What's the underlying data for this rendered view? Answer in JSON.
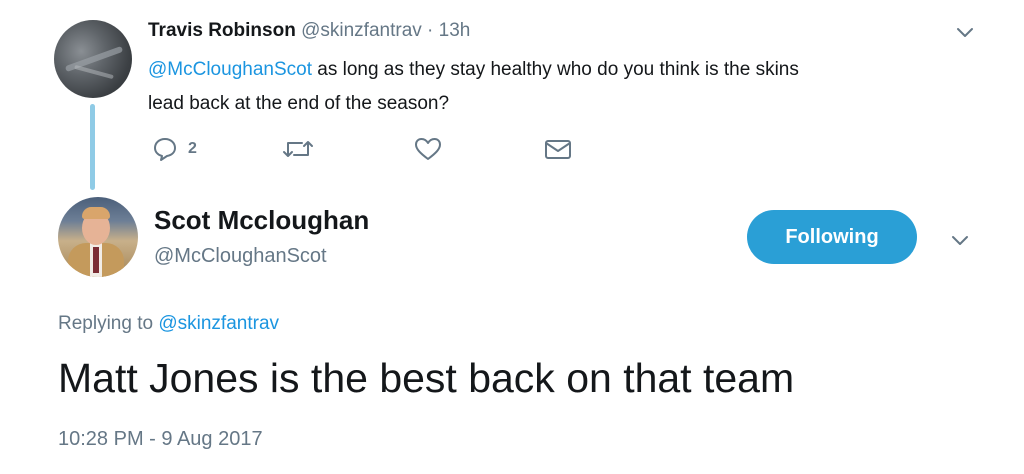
{
  "parent_tweet": {
    "author_name": "Travis Robinson",
    "author_handle": "@skinzfantrav",
    "separator": "·",
    "time": "13h",
    "mention": "@McCloughanScot",
    "text_line1": " as long as they stay healthy who do you think is the skins",
    "text_line2": "lead back at the end of the season?",
    "reply_count": "2",
    "icons": [
      "reply-icon",
      "retweet-icon",
      "like-icon",
      "message-icon",
      "chevron-down-icon"
    ]
  },
  "main_tweet": {
    "author_name": "Scot Mccloughan",
    "author_handle": "@McCloughanScot",
    "follow_label": "Following",
    "replying_prefix": "Replying to ",
    "replying_to": "@skinzfantrav",
    "text": "Matt Jones is the best back on that team",
    "timestamp": "10:28 PM - 9 Aug 2017"
  },
  "colors": {
    "accent": "#1b95e0",
    "follow_button": "#2a9fd6",
    "thread_line": "#8fcbe6",
    "secondary_text": "#657786",
    "primary_text": "#14171a"
  }
}
